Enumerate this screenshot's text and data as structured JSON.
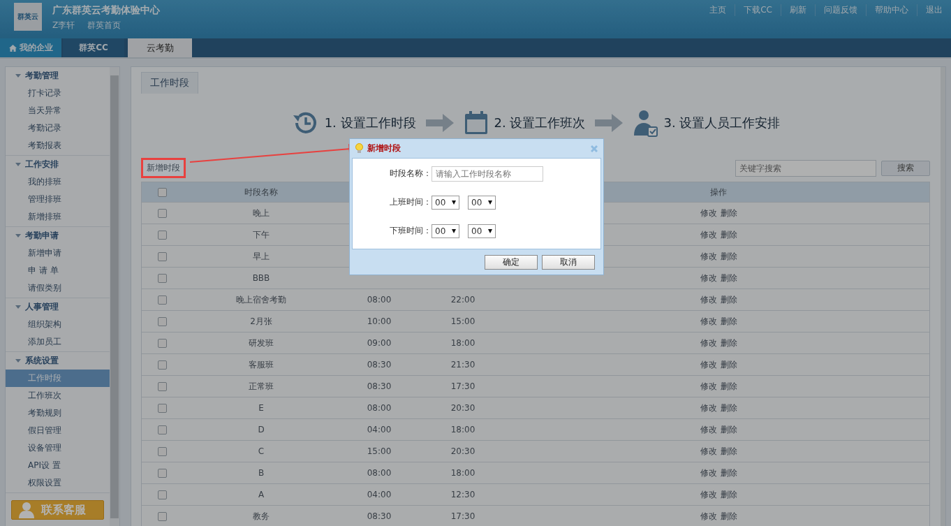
{
  "header": {
    "logo_text": "群英云",
    "title": "广东群英云考勤体验中心",
    "user": "Z李轩",
    "home_link": "群英首页",
    "top_links": [
      "主页",
      "下载CC",
      "刷新",
      "问题反馈",
      "帮助中心",
      "退出"
    ]
  },
  "nav_tabs": [
    {
      "label": "我的企业",
      "kind": "home",
      "selected": false
    },
    {
      "label": "群英CC",
      "kind": "plain",
      "selected": false
    },
    {
      "label": "云考勤",
      "kind": "plain",
      "selected": true
    }
  ],
  "sidebar": {
    "groups": [
      {
        "title": "考勤管理",
        "expanded": true,
        "items": [
          {
            "label": "打卡记录",
            "selected": false
          },
          {
            "label": "当天异常",
            "selected": false
          },
          {
            "label": "考勤记录",
            "selected": false
          },
          {
            "label": "考勤报表",
            "selected": false
          }
        ]
      },
      {
        "title": "工作安排",
        "expanded": true,
        "items": [
          {
            "label": "我的排班",
            "selected": false
          },
          {
            "label": "管理排班",
            "selected": false
          },
          {
            "label": "新增排班",
            "selected": false
          }
        ]
      },
      {
        "title": "考勤申请",
        "expanded": true,
        "items": [
          {
            "label": "新增申请",
            "selected": false
          },
          {
            "label": "申 请 单",
            "selected": false
          },
          {
            "label": "请假类别",
            "selected": false
          }
        ]
      },
      {
        "title": "人事管理",
        "expanded": true,
        "items": [
          {
            "label": "组织架构",
            "selected": false
          },
          {
            "label": "添加员工",
            "selected": false
          }
        ]
      },
      {
        "title": "系统设置",
        "expanded": true,
        "items": [
          {
            "label": "工作时段",
            "selected": true
          },
          {
            "label": "工作班次",
            "selected": false
          },
          {
            "label": "考勤规则",
            "selected": false
          },
          {
            "label": "假日管理",
            "selected": false
          },
          {
            "label": "设备管理",
            "selected": false
          },
          {
            "label": "API设 置",
            "selected": false
          },
          {
            "label": "权限设置",
            "selected": false
          }
        ]
      }
    ],
    "contact_button": "联系客服"
  },
  "panel": {
    "title": "工作时段",
    "steps": [
      {
        "label": "1. 设置工作时段",
        "kind": "clock"
      },
      {
        "label": "2. 设置工作班次",
        "kind": "calendar"
      },
      {
        "label": "3. 设置人员工作安排",
        "kind": "person"
      }
    ],
    "add_button": "新增时段",
    "search": {
      "placeholder": "关键字搜索"
    },
    "search_button": "搜索",
    "table": {
      "header_checked": false,
      "column_name": "时段名称",
      "column_actions": "操作",
      "rows": [
        {
          "name": "晚上",
          "checked": false,
          "actions": [
            "修改",
            "删除"
          ]
        },
        {
          "name": "下午",
          "checked": false,
          "actions": [
            "修改",
            "删除"
          ]
        },
        {
          "name": "早上",
          "checked": false,
          "actions": [
            "修改",
            "删除"
          ]
        },
        {
          "name": "BBB",
          "checked": false,
          "actions": [
            "修改",
            "删除"
          ]
        },
        {
          "name": "晚上宿舍考勤",
          "start": "08:00",
          "end": "22:00",
          "checked": false,
          "actions": [
            "修改",
            "删除"
          ]
        },
        {
          "name": "2月张",
          "start": "10:00",
          "end": "15:00",
          "checked": false,
          "actions": [
            "修改",
            "删除"
          ]
        },
        {
          "name": "研发班",
          "start": "09:00",
          "end": "18:00",
          "checked": false,
          "actions": [
            "修改",
            "删除"
          ]
        },
        {
          "name": "客服班",
          "start": "08:30",
          "end": "21:30",
          "checked": false,
          "actions": [
            "修改",
            "删除"
          ]
        },
        {
          "name": "正常班",
          "start": "08:30",
          "end": "17:30",
          "checked": false,
          "actions": [
            "修改",
            "删除"
          ]
        },
        {
          "name": "E",
          "start": "08:00",
          "end": "20:30",
          "checked": false,
          "actions": [
            "修改",
            "删除"
          ]
        },
        {
          "name": "D",
          "start": "04:00",
          "end": "18:00",
          "checked": false,
          "actions": [
            "修改",
            "删除"
          ]
        },
        {
          "name": "C",
          "start": "15:00",
          "end": "20:30",
          "checked": false,
          "actions": [
            "修改",
            "删除"
          ]
        },
        {
          "name": "B",
          "start": "08:00",
          "end": "18:00",
          "checked": false,
          "actions": [
            "修改",
            "删除"
          ]
        },
        {
          "name": "A",
          "start": "04:00",
          "end": "12:30",
          "checked": false,
          "actions": [
            "修改",
            "删除"
          ]
        },
        {
          "name": "教务",
          "start": "08:30",
          "end": "17:30",
          "checked": false,
          "actions": [
            "修改",
            "删除"
          ]
        }
      ]
    }
  },
  "modal": {
    "title": "新增时段",
    "fields": [
      {
        "kind": "text",
        "label": "时段名称：",
        "placeholder": "请输入工作时段名称"
      },
      {
        "kind": "time",
        "label": "上班时间：",
        "hour": "00",
        "minute": "00"
      },
      {
        "kind": "time",
        "label": "下班时间：",
        "hour": "00",
        "minute": "00"
      }
    ],
    "buttons": [
      "确定",
      "取消"
    ]
  }
}
